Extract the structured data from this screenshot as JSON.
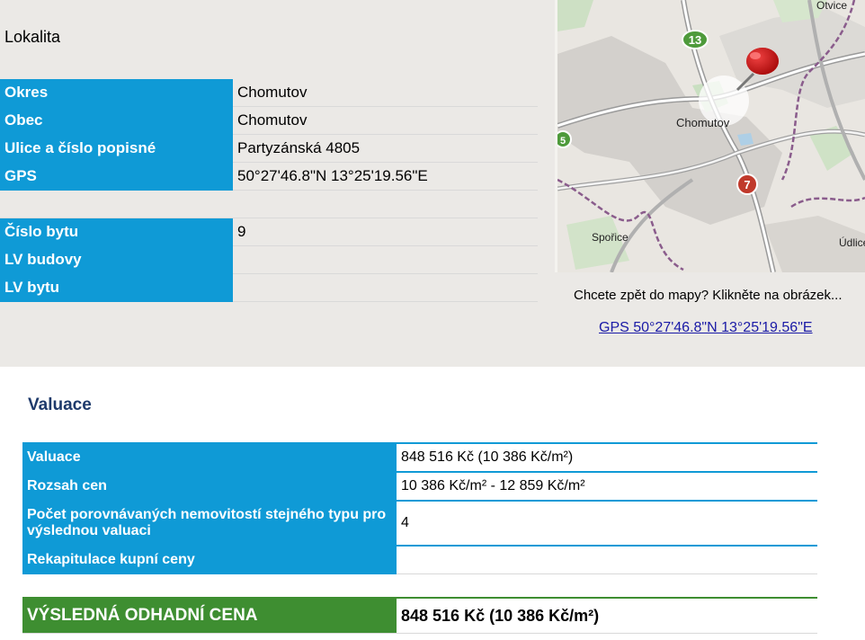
{
  "lokalita": {
    "heading": "Lokalita",
    "rows": [
      {
        "label": "Okres",
        "value": "Chomutov"
      },
      {
        "label": "Obec",
        "value": "Chomutov"
      },
      {
        "label": "Ulice a číslo popisné",
        "value": "Partyzánská 4805"
      },
      {
        "label": "GPS",
        "value": "50°27'46.8\"N 13°25'19.56\"E"
      }
    ],
    "rows2": [
      {
        "label": "Číslo bytu",
        "value": "9"
      },
      {
        "label": "LV budovy",
        "value": ""
      },
      {
        "label": "LV bytu",
        "value": ""
      }
    ]
  },
  "map": {
    "labels": {
      "city": "Chomutov",
      "spořice": "Spořice",
      "udlice": "Údlice",
      "otvice": "Otvice",
      "route13": "13",
      "route7": "7",
      "route_left": "5"
    },
    "marker_icon": "red-pushpin-icon",
    "caption": "Chcete zpět do mapy? Klikněte na obrázek...",
    "gps_link": "GPS 50°27'46.8\"N 13°25'19.56\"E"
  },
  "valuace": {
    "heading": "Valuace",
    "rows": [
      {
        "label": "Valuace",
        "value": "848 516 Kč (10 386 Kč/m²)"
      },
      {
        "label": "Rozsah cen",
        "value": "10 386 Kč/m² - 12 859 Kč/m²"
      },
      {
        "label": "Počet porovnávaných nemovitostí stejného typu pro výslednou valuaci",
        "value": "4"
      },
      {
        "label": "Rekapitulace kupní ceny",
        "value": ""
      }
    ],
    "result": {
      "label": "VÝSLEDNÁ ODHADNÍ CENA",
      "value": "848 516 Kč (10 386 Kč/m²)"
    }
  },
  "colors": {
    "label_blue": "#0f9ad6",
    "result_green": "#3e8e31",
    "heading_navy": "#1e3a6b",
    "top_bg": "#ebe9e6",
    "link": "#1a1aa6"
  }
}
